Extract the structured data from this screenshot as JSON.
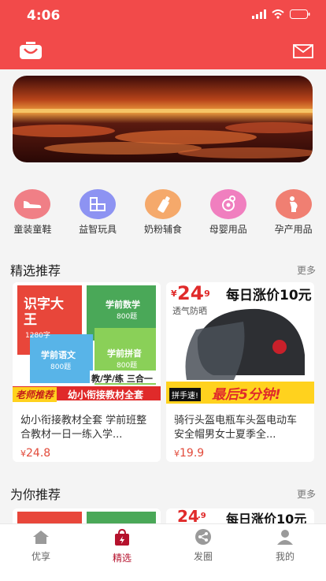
{
  "status": {
    "time": "4:06"
  },
  "categories": [
    {
      "label": "童装童鞋",
      "icon": "shoe-icon",
      "color": "#f07f86"
    },
    {
      "label": "益智玩具",
      "icon": "blocks-icon",
      "color": "#8d93f2"
    },
    {
      "label": "奶粉辅食",
      "icon": "bottle-icon",
      "color": "#f5a96b"
    },
    {
      "label": "母婴用品",
      "icon": "pacifier-icon",
      "color": "#f07fbf"
    },
    {
      "label": "孕产用品",
      "icon": "pregnant-icon",
      "color": "#f07f72"
    }
  ],
  "featured": {
    "title": "精选推荐",
    "more": "更多",
    "products": [
      {
        "title": "幼小衔接教材全套 学前班整合教材一日一练入学...",
        "currency": "¥",
        "price": "24.8",
        "img": {
          "book1": "识字大王",
          "book1_count": "1280字",
          "book2": "学前数学",
          "book2_count": "800题",
          "book3": "学前语文",
          "book3_count": "800题",
          "book4": "学前拼音",
          "book4_count": "800题",
          "tag_combo": "教/学/练 三合一",
          "tag_teacher": "老师推荐",
          "tag_banner": "幼小衔接教材全套"
        }
      },
      {
        "title": "骑行头盔电瓶车头盔电动车安全帽男女士夏季全...",
        "currency": "¥",
        "price": "19.9",
        "img": {
          "price_prefix": "¥",
          "price_main": "24",
          "price_suffix": ".9",
          "headline": "每日涨价10元",
          "sub": "透气防晒",
          "hurry": "拼手速!",
          "countdown": "最后5分钟!"
        }
      }
    ]
  },
  "for_you": {
    "title": "为你推荐",
    "more": "更多",
    "peek_price_main": "24",
    "peek_price_suffix": ".9",
    "peek_headline": "每日涨价10元"
  },
  "tabs": [
    {
      "label": "优享",
      "icon": "home-icon",
      "active": false
    },
    {
      "label": "精选",
      "icon": "bag-icon",
      "active": true
    },
    {
      "label": "发圈",
      "icon": "share-icon",
      "active": false
    },
    {
      "label": "我的",
      "icon": "user-icon",
      "active": false
    }
  ],
  "colors": {
    "brand": "#f24a4a",
    "price": "#e24a3a",
    "tab_active": "#b5122d"
  }
}
